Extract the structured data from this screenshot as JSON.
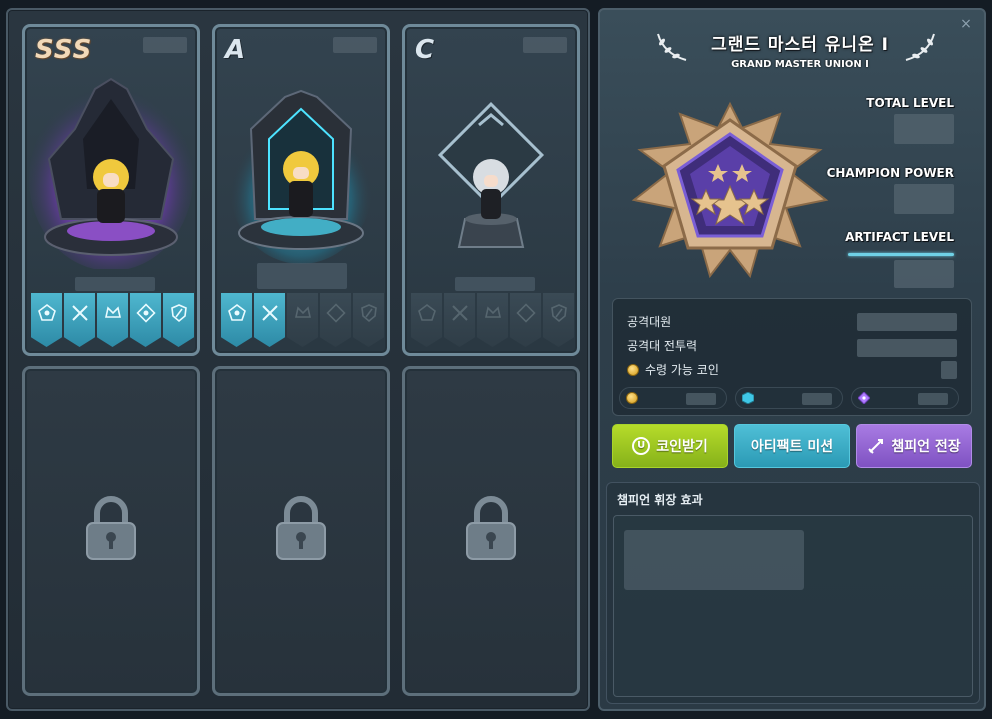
{
  "cards": [
    {
      "grade": "SSS",
      "grade_class": "grade-sss",
      "badges": [
        "on",
        "on",
        "on",
        "on",
        "on"
      ]
    },
    {
      "grade": "A",
      "grade_class": "grade-a",
      "badges": [
        "on",
        "on",
        "off",
        "off",
        "off"
      ]
    },
    {
      "grade": "C",
      "grade_class": "grade-c",
      "badges": [
        "off",
        "off",
        "off",
        "off",
        "off"
      ]
    }
  ],
  "header": {
    "title": "그랜드 마스터 유니온 Ⅰ",
    "subtitle": "GRAND MASTER UNION Ⅰ",
    "close_symbol": "×"
  },
  "stats": {
    "total_level_label": "TOTAL LEVEL",
    "champion_power_label": "CHAMPION POWER",
    "artifact_level_label": "ARTIFACT LEVEL"
  },
  "info": {
    "raid_members_label": "공격대원",
    "raid_power_label": "공격대 전투력",
    "claimable_coin_label": "수령 가능 코인"
  },
  "buttons": {
    "receive_coin": "코인받기",
    "artifact_mission": "아티팩트 미션",
    "champion_battle": "챔피언 전장",
    "coin_symbol": "U"
  },
  "effect": {
    "title": "챔피언 휘장 효과"
  },
  "colors": {
    "accent_green": "#9cc823",
    "accent_cyan": "#3fb0cb",
    "accent_purple": "#9568d6",
    "badge_on": "#4fb7cf",
    "grade_sss": "#f2d9b8"
  },
  "icons": {
    "badges": [
      "pentagon-badge-icon",
      "crossed-swords-icon",
      "crown-icon",
      "shield-target-icon",
      "shield-slash-icon"
    ],
    "lock": "lock-icon",
    "coin": "coin-icon",
    "gem": "gem-icon",
    "artifact": "artifact-icon",
    "sword": "sword-icon"
  }
}
